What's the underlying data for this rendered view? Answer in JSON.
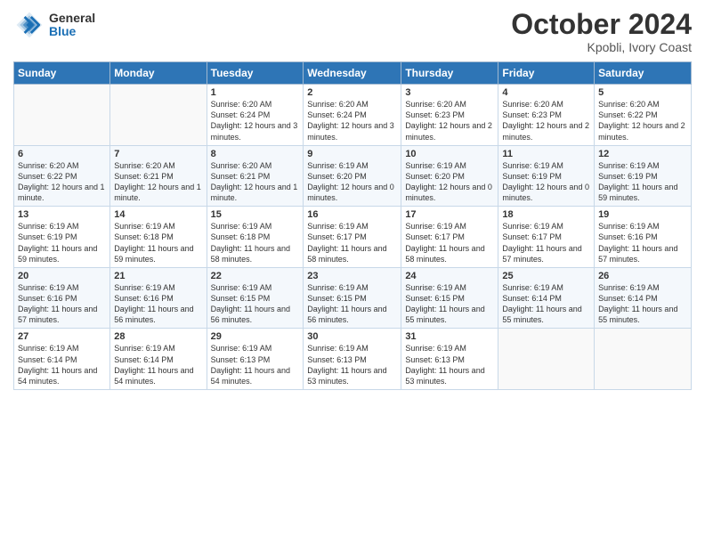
{
  "header": {
    "logo_line1": "General",
    "logo_line2": "Blue",
    "month": "October 2024",
    "location": "Kpobli, Ivory Coast"
  },
  "weekdays": [
    "Sunday",
    "Monday",
    "Tuesday",
    "Wednesday",
    "Thursday",
    "Friday",
    "Saturday"
  ],
  "weeks": [
    [
      {
        "day": "",
        "text": ""
      },
      {
        "day": "",
        "text": ""
      },
      {
        "day": "1",
        "text": "Sunrise: 6:20 AM\nSunset: 6:24 PM\nDaylight: 12 hours and 3 minutes."
      },
      {
        "day": "2",
        "text": "Sunrise: 6:20 AM\nSunset: 6:24 PM\nDaylight: 12 hours and 3 minutes."
      },
      {
        "day": "3",
        "text": "Sunrise: 6:20 AM\nSunset: 6:23 PM\nDaylight: 12 hours and 2 minutes."
      },
      {
        "day": "4",
        "text": "Sunrise: 6:20 AM\nSunset: 6:23 PM\nDaylight: 12 hours and 2 minutes."
      },
      {
        "day": "5",
        "text": "Sunrise: 6:20 AM\nSunset: 6:22 PM\nDaylight: 12 hours and 2 minutes."
      }
    ],
    [
      {
        "day": "6",
        "text": "Sunrise: 6:20 AM\nSunset: 6:22 PM\nDaylight: 12 hours and 1 minute."
      },
      {
        "day": "7",
        "text": "Sunrise: 6:20 AM\nSunset: 6:21 PM\nDaylight: 12 hours and 1 minute."
      },
      {
        "day": "8",
        "text": "Sunrise: 6:20 AM\nSunset: 6:21 PM\nDaylight: 12 hours and 1 minute."
      },
      {
        "day": "9",
        "text": "Sunrise: 6:19 AM\nSunset: 6:20 PM\nDaylight: 12 hours and 0 minutes."
      },
      {
        "day": "10",
        "text": "Sunrise: 6:19 AM\nSunset: 6:20 PM\nDaylight: 12 hours and 0 minutes."
      },
      {
        "day": "11",
        "text": "Sunrise: 6:19 AM\nSunset: 6:19 PM\nDaylight: 12 hours and 0 minutes."
      },
      {
        "day": "12",
        "text": "Sunrise: 6:19 AM\nSunset: 6:19 PM\nDaylight: 11 hours and 59 minutes."
      }
    ],
    [
      {
        "day": "13",
        "text": "Sunrise: 6:19 AM\nSunset: 6:19 PM\nDaylight: 11 hours and 59 minutes."
      },
      {
        "day": "14",
        "text": "Sunrise: 6:19 AM\nSunset: 6:18 PM\nDaylight: 11 hours and 59 minutes."
      },
      {
        "day": "15",
        "text": "Sunrise: 6:19 AM\nSunset: 6:18 PM\nDaylight: 11 hours and 58 minutes."
      },
      {
        "day": "16",
        "text": "Sunrise: 6:19 AM\nSunset: 6:17 PM\nDaylight: 11 hours and 58 minutes."
      },
      {
        "day": "17",
        "text": "Sunrise: 6:19 AM\nSunset: 6:17 PM\nDaylight: 11 hours and 58 minutes."
      },
      {
        "day": "18",
        "text": "Sunrise: 6:19 AM\nSunset: 6:17 PM\nDaylight: 11 hours and 57 minutes."
      },
      {
        "day": "19",
        "text": "Sunrise: 6:19 AM\nSunset: 6:16 PM\nDaylight: 11 hours and 57 minutes."
      }
    ],
    [
      {
        "day": "20",
        "text": "Sunrise: 6:19 AM\nSunset: 6:16 PM\nDaylight: 11 hours and 57 minutes."
      },
      {
        "day": "21",
        "text": "Sunrise: 6:19 AM\nSunset: 6:16 PM\nDaylight: 11 hours and 56 minutes."
      },
      {
        "day": "22",
        "text": "Sunrise: 6:19 AM\nSunset: 6:15 PM\nDaylight: 11 hours and 56 minutes."
      },
      {
        "day": "23",
        "text": "Sunrise: 6:19 AM\nSunset: 6:15 PM\nDaylight: 11 hours and 56 minutes."
      },
      {
        "day": "24",
        "text": "Sunrise: 6:19 AM\nSunset: 6:15 PM\nDaylight: 11 hours and 55 minutes."
      },
      {
        "day": "25",
        "text": "Sunrise: 6:19 AM\nSunset: 6:14 PM\nDaylight: 11 hours and 55 minutes."
      },
      {
        "day": "26",
        "text": "Sunrise: 6:19 AM\nSunset: 6:14 PM\nDaylight: 11 hours and 55 minutes."
      }
    ],
    [
      {
        "day": "27",
        "text": "Sunrise: 6:19 AM\nSunset: 6:14 PM\nDaylight: 11 hours and 54 minutes."
      },
      {
        "day": "28",
        "text": "Sunrise: 6:19 AM\nSunset: 6:14 PM\nDaylight: 11 hours and 54 minutes."
      },
      {
        "day": "29",
        "text": "Sunrise: 6:19 AM\nSunset: 6:13 PM\nDaylight: 11 hours and 54 minutes."
      },
      {
        "day": "30",
        "text": "Sunrise: 6:19 AM\nSunset: 6:13 PM\nDaylight: 11 hours and 53 minutes."
      },
      {
        "day": "31",
        "text": "Sunrise: 6:19 AM\nSunset: 6:13 PM\nDaylight: 11 hours and 53 minutes."
      },
      {
        "day": "",
        "text": ""
      },
      {
        "day": "",
        "text": ""
      }
    ]
  ]
}
